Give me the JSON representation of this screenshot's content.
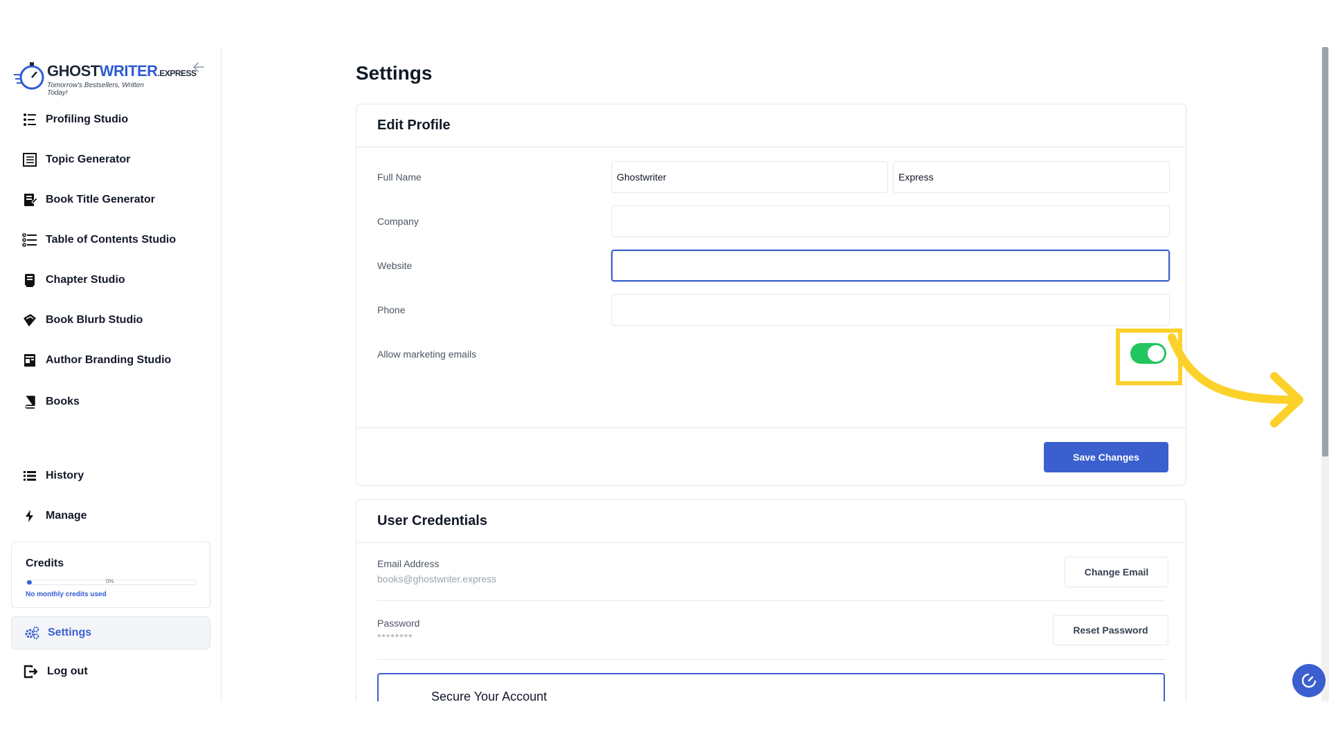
{
  "brand": {
    "name_part1": "GHOST",
    "name_part2": "WRITER",
    "name_part3": ".EXPRESS",
    "tagline": "Tomorrow's Bestsellers, Written Today!"
  },
  "sidebar": {
    "items": [
      {
        "label": "Profiling Studio",
        "icon": "profiling-icon"
      },
      {
        "label": "Topic Generator",
        "icon": "topic-icon"
      },
      {
        "label": "Book Title Generator",
        "icon": "title-icon"
      },
      {
        "label": "Table of Contents Studio",
        "icon": "toc-icon"
      },
      {
        "label": "Chapter Studio",
        "icon": "chapter-icon"
      },
      {
        "label": "Book Blurb Studio",
        "icon": "blurb-icon"
      },
      {
        "label": "Author Branding Studio",
        "icon": "branding-icon"
      },
      {
        "label": "Books",
        "icon": "book-icon"
      },
      {
        "label": "History",
        "icon": "list-icon"
      },
      {
        "label": "Manage",
        "icon": "bolt-icon"
      }
    ],
    "credits": {
      "title": "Credits",
      "percent": "0%",
      "progress": 0.03,
      "note": "No monthly credits used"
    },
    "settings_label": "Settings",
    "logout_label": "Log out"
  },
  "page": {
    "title": "Settings"
  },
  "edit_profile": {
    "heading": "Edit Profile",
    "full_name_label": "Full Name",
    "first_name": "Ghostwriter",
    "last_name": "Express",
    "company_label": "Company",
    "company_value": "",
    "website_label": "Website",
    "website_value": "",
    "phone_label": "Phone",
    "phone_value": "",
    "marketing_label": "Allow marketing emails",
    "marketing_enabled": true,
    "save_label": "Save Changes"
  },
  "credentials": {
    "heading": "User Credentials",
    "email_label": "Email Address",
    "email_value": "books@ghostwriter.express",
    "change_email_label": "Change Email",
    "password_label": "Password",
    "password_value": "********",
    "reset_password_label": "Reset Password",
    "secure_title": "Secure Your Account"
  },
  "colors": {
    "accent": "#3b5fce",
    "toggle_on": "#22c55e",
    "highlight": "#fcd12a"
  }
}
